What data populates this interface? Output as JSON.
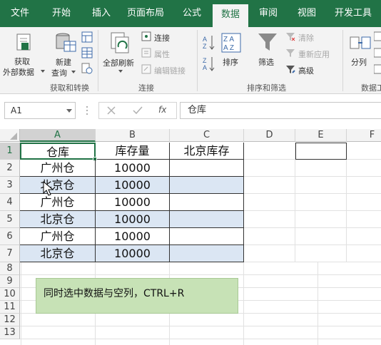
{
  "tabs": [
    "文件",
    "开始",
    "插入",
    "页面布局",
    "公式",
    "数据",
    "审阅",
    "视图",
    "开发工具"
  ],
  "ribbon": {
    "get_external_line1": "获取",
    "get_external_line2": "外部数据",
    "new_query_line1": "新建",
    "new_query_line2": "查询",
    "group_get_transform": "获取和转换",
    "refresh_all": "全部刷新",
    "connections": "连接",
    "properties": "属性",
    "edit_links": "编辑链接",
    "group_connections": "连接",
    "sort": "排序",
    "filter": "筛选",
    "clear": "清除",
    "reapply": "重新应用",
    "advanced": "高级",
    "group_sort_filter": "排序和筛选",
    "split": "分列",
    "group_data_tools": "数据工"
  },
  "formula_bar": {
    "name_box": "A1",
    "fx": "fx",
    "content": "仓库"
  },
  "grid": {
    "columns": [
      "A",
      "B",
      "C",
      "D",
      "E",
      "F"
    ],
    "rows": [
      "1",
      "2",
      "3",
      "4",
      "5",
      "6",
      "7",
      "8",
      "9",
      "10",
      "11",
      "12",
      "13"
    ],
    "table": [
      [
        "仓库",
        "库存量",
        "北京库存"
      ],
      [
        "广州仓",
        "10000",
        ""
      ],
      [
        "北京仓",
        "10000",
        ""
      ],
      [
        "广州仓",
        "10000",
        ""
      ],
      [
        "北京仓",
        "10000",
        ""
      ],
      [
        "广州仓",
        "10000",
        ""
      ],
      [
        "北京仓",
        "10000",
        ""
      ]
    ]
  },
  "note": "同时选中数据与空列，CTRL+R",
  "colors": {
    "excel_green": "#217346",
    "highlight_blue": "#dbe6f3",
    "note_green": "#c7e2b6"
  }
}
